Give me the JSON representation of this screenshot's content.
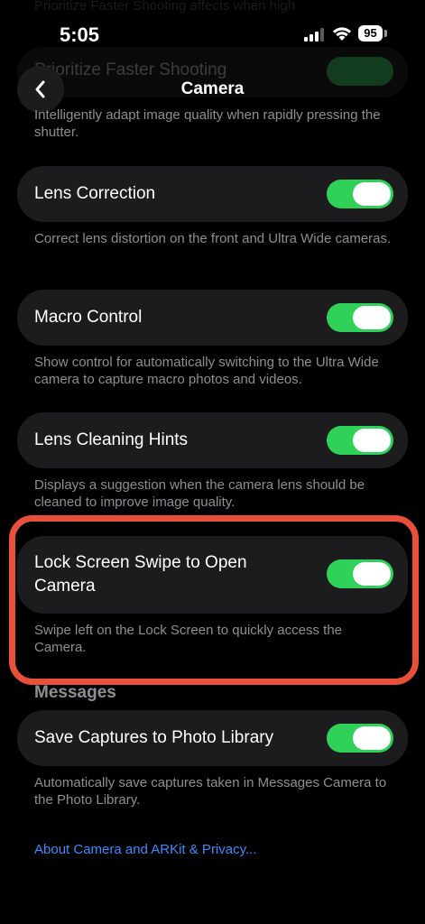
{
  "ghost": {
    "top_text": "Prioritize Faster Shooting affects when high",
    "label": "Prioritize Faster Shooting"
  },
  "status_bar": {
    "time": "5:05",
    "battery": "95"
  },
  "nav": {
    "title": "Camera"
  },
  "rows": [
    {
      "label": "Intelligently adapt image quality when rapidly pressing the shutter."
    },
    {
      "label": "Lens Correction",
      "on": true,
      "description": "Correct lens distortion on the front and Ultra Wide cameras."
    },
    {
      "label": "Macro Control",
      "on": true,
      "description": "Show control for automatically switching to the Ultra Wide camera to capture macro photos and videos."
    },
    {
      "label": "Lens Cleaning Hints",
      "on": true,
      "description": "Displays a suggestion when the camera lens should be cleaned to improve image quality."
    },
    {
      "label": "Lock Screen Swipe to Open Camera",
      "on": true,
      "description": "Swipe left on the Lock Screen to quickly access the Camera."
    }
  ],
  "messages": {
    "header": "Messages",
    "label": "Save Captures to Photo Library",
    "on": true,
    "description": "Automatically save captures taken in Messages Camera to the Photo Library."
  },
  "footer_link": "About Camera and ARKit & Privacy...",
  "colors": {
    "accent_green": "#30d158",
    "link_blue": "#3d8bfd",
    "highlight_red": "#e8503a"
  }
}
